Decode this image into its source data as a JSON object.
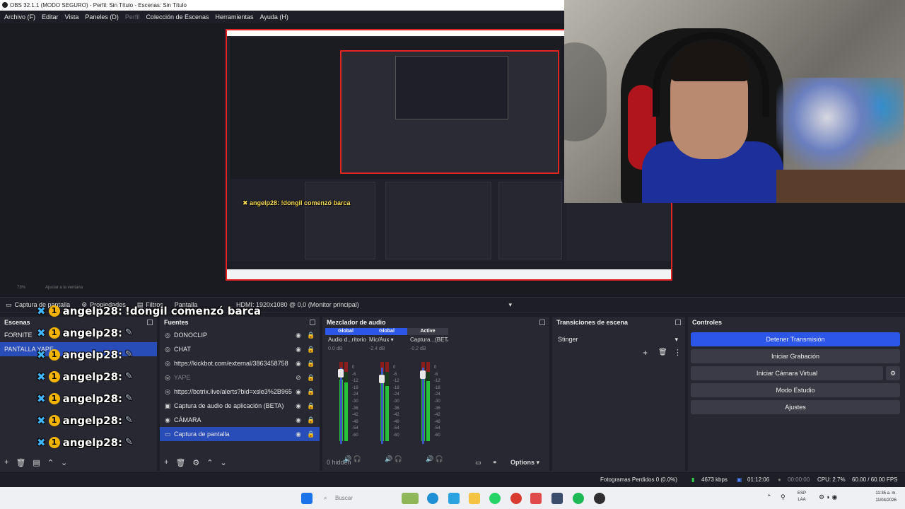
{
  "window": {
    "title": "OBS 32.1.1 (MODO SEGURO) - Perfil: Sin Título - Escenas: Sin Título"
  },
  "menu": [
    {
      "label": "Archivo (F)",
      "disabled": false
    },
    {
      "label": "Editar",
      "disabled": false
    },
    {
      "label": "Vista",
      "disabled": false
    },
    {
      "label": "Paneles (D)",
      "disabled": false
    },
    {
      "label": "Perfil",
      "disabled": true
    },
    {
      "label": "Colección de Escenas",
      "disabled": false
    },
    {
      "label": "Herramientas",
      "disabled": false
    },
    {
      "label": "Ayuda (H)",
      "disabled": false
    }
  ],
  "preview": {
    "zoom": "73%",
    "fit_label": "Ajustar a la ventana"
  },
  "source_toolbar": {
    "source_name": "Captura de pantalla",
    "properties_label": "Propiedades",
    "filters_label": "Filtros",
    "screen_label": "Pantalla",
    "monitor_value": "HDMI: 1920x1080 @ 0,0 (Monitor principal)"
  },
  "scenes": {
    "title": "Escenas",
    "items": [
      {
        "label": "FORNITE",
        "selected": false
      },
      {
        "label": "PANTALLA YAPE",
        "selected": true
      }
    ]
  },
  "sources": {
    "title": "Fuentes",
    "items": [
      {
        "icon": "browser-icon",
        "glyph": "◎",
        "label": "DONOCLIP",
        "visible": true,
        "selected": false
      },
      {
        "icon": "browser-icon",
        "glyph": "◎",
        "label": "CHAT",
        "visible": true,
        "selected": false
      },
      {
        "icon": "browser-icon",
        "glyph": "◎",
        "label": "https://kickbot.com/external/3863458758",
        "visible": true,
        "selected": false
      },
      {
        "icon": "browser-icon",
        "glyph": "◎",
        "label": "YAPE",
        "visible": false,
        "selected": false
      },
      {
        "icon": "browser-icon",
        "glyph": "◎",
        "label": "https://botrix.live/alerts?bid=xsle3%2B965",
        "visible": true,
        "selected": false
      },
      {
        "icon": "app-audio-icon",
        "glyph": "▣",
        "label": "Captura de audio de aplicación (BETA)",
        "visible": true,
        "selected": false
      },
      {
        "icon": "camera-icon",
        "glyph": "◉",
        "label": "CÁMARA",
        "visible": true,
        "selected": false
      },
      {
        "icon": "monitor-icon",
        "glyph": "▭",
        "label": "Captura de pantalla",
        "visible": true,
        "selected": true
      }
    ]
  },
  "mixer": {
    "title": "Mezclador de audio",
    "hidden_label": "0 hidden",
    "options_label": "Options",
    "channels": [
      {
        "badge": "Global",
        "badge_color": "#2b56e8",
        "name": "Audio d...ritorio",
        "db": "0.0 dB",
        "level": 0.78,
        "fader": 0.98
      },
      {
        "badge": "Global",
        "badge_color": "#2b56e8",
        "name": "Mic/Aux",
        "db": "-2.4 dB",
        "level": 0.74,
        "fader": 0.9
      },
      {
        "badge": "Active",
        "badge_color": "#3a3b46",
        "name": "Captura...(BETA)",
        "db": "-0.2 dB",
        "level": 0.8,
        "fader": 0.96
      }
    ],
    "scale": [
      "0",
      "-6",
      "-12",
      "-18",
      "-24",
      "-30",
      "-36",
      "-42",
      "-48",
      "-54",
      "-60"
    ]
  },
  "transitions": {
    "title": "Transiciones de escena",
    "selected": "Stinger"
  },
  "controls": {
    "title": "Controles",
    "stop_stream": "Detener Transmisión",
    "start_recording": "Iniciar Grabación",
    "start_virtual_cam": "Iniciar Cámara Virtual",
    "studio_mode": "Modo Estudio",
    "settings": "Ajustes"
  },
  "status": {
    "dropped_frames": "Fotogramas Perdidos 0 (0.0%)",
    "bitrate": "4673 kbps",
    "stream_time": "01:12:06",
    "record_time": "00:00:00",
    "cpu": "CPU: 2.7%",
    "fps": "60.00 / 60.00 FPS"
  },
  "chat_overlay": {
    "lines": [
      {
        "user": "angelp28:",
        "message": "!dongil comenzó barca"
      },
      {
        "user": "angelp28:",
        "message": ""
      },
      {
        "user": "angelp28:",
        "message": ""
      },
      {
        "user": "angelp28:",
        "message": ""
      },
      {
        "user": "angelp28:",
        "message": ""
      },
      {
        "user": "angelp28:",
        "message": ""
      },
      {
        "user": "angelp28:",
        "message": ""
      }
    ]
  },
  "taskbar": {
    "search_placeholder": "Buscar",
    "lang_top": "ESP",
    "lang_bottom": "LAA",
    "time": "11:35 a. m.",
    "date": "11/04/2026"
  }
}
